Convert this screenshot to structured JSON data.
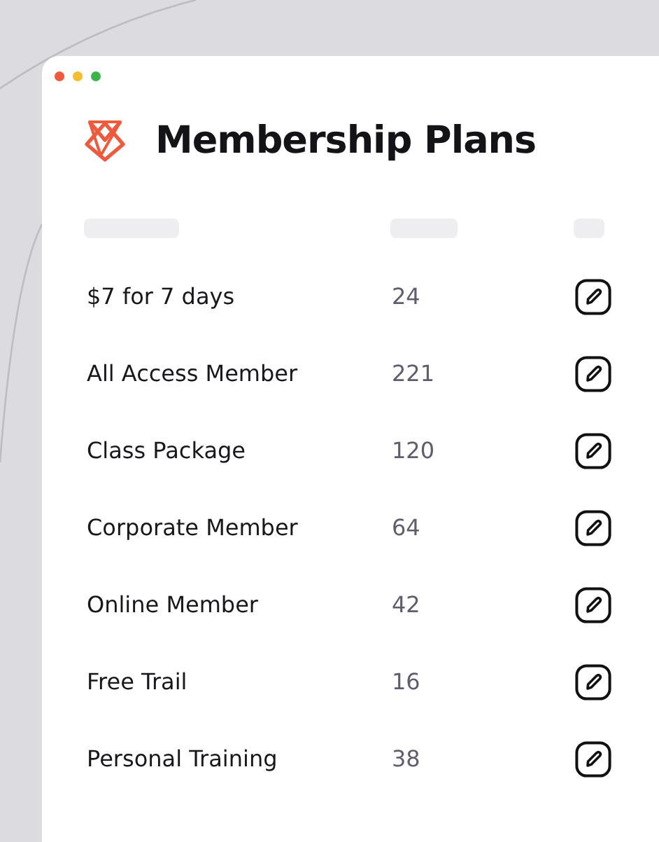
{
  "window": {
    "controls": [
      {
        "color": "#f05a3c"
      },
      {
        "color": "#f5bd2f"
      },
      {
        "color": "#3bb54a"
      }
    ]
  },
  "title": "Membership Plans",
  "table": {
    "columns": [
      {
        "kind": "skeleton"
      },
      {
        "kind": "skeleton"
      },
      {
        "kind": "skeleton"
      }
    ],
    "rows": [
      {
        "name": "$7 for 7 days",
        "count": "24"
      },
      {
        "name": "All Access Member",
        "count": "221"
      },
      {
        "name": "Class Package",
        "count": "120"
      },
      {
        "name": "Corporate Member",
        "count": "64"
      },
      {
        "name": "Online Member",
        "count": "42"
      },
      {
        "name": "Free Trail",
        "count": "16"
      },
      {
        "name": "Personal Training",
        "count": "38"
      }
    ]
  }
}
